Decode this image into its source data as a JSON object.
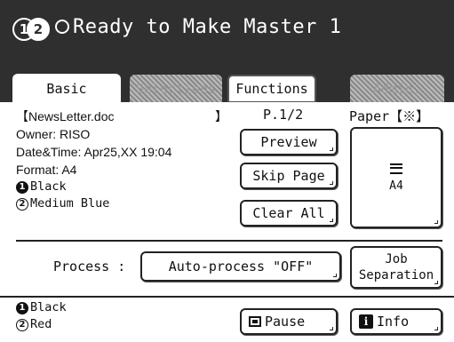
{
  "status": {
    "drum1": "1",
    "drum2": "2",
    "message": "Ready to Make Master 1"
  },
  "tabs": {
    "basic": "Basic",
    "selections": "Selections",
    "functions": "Functions",
    "admin": "Admin."
  },
  "document": {
    "name": "【NewsLetter.doc",
    "bracket_close": "】",
    "owner": "Owner: RISO",
    "datetime": "Date&Time: Apr25,XX 19:04",
    "format": "Format: A4",
    "ink1": "Black",
    "ink2": "Medium Blue"
  },
  "page": "P.1/2",
  "paper": {
    "label": "Paper【※】",
    "size": "A4"
  },
  "buttons": {
    "preview": "Preview",
    "skip_page": "Skip Page",
    "clear_all": "Clear All",
    "process_label": "Process :",
    "process_value": "Auto-process \"OFF\"",
    "job_line1": "Job",
    "job_line2": "Separation",
    "pause": "Pause",
    "info": "Info"
  },
  "current_drums": {
    "ink1": "Black",
    "ink2": "Red"
  },
  "colors": {
    "status_bar": "#2f2f2f",
    "panel": "#ffffff"
  }
}
